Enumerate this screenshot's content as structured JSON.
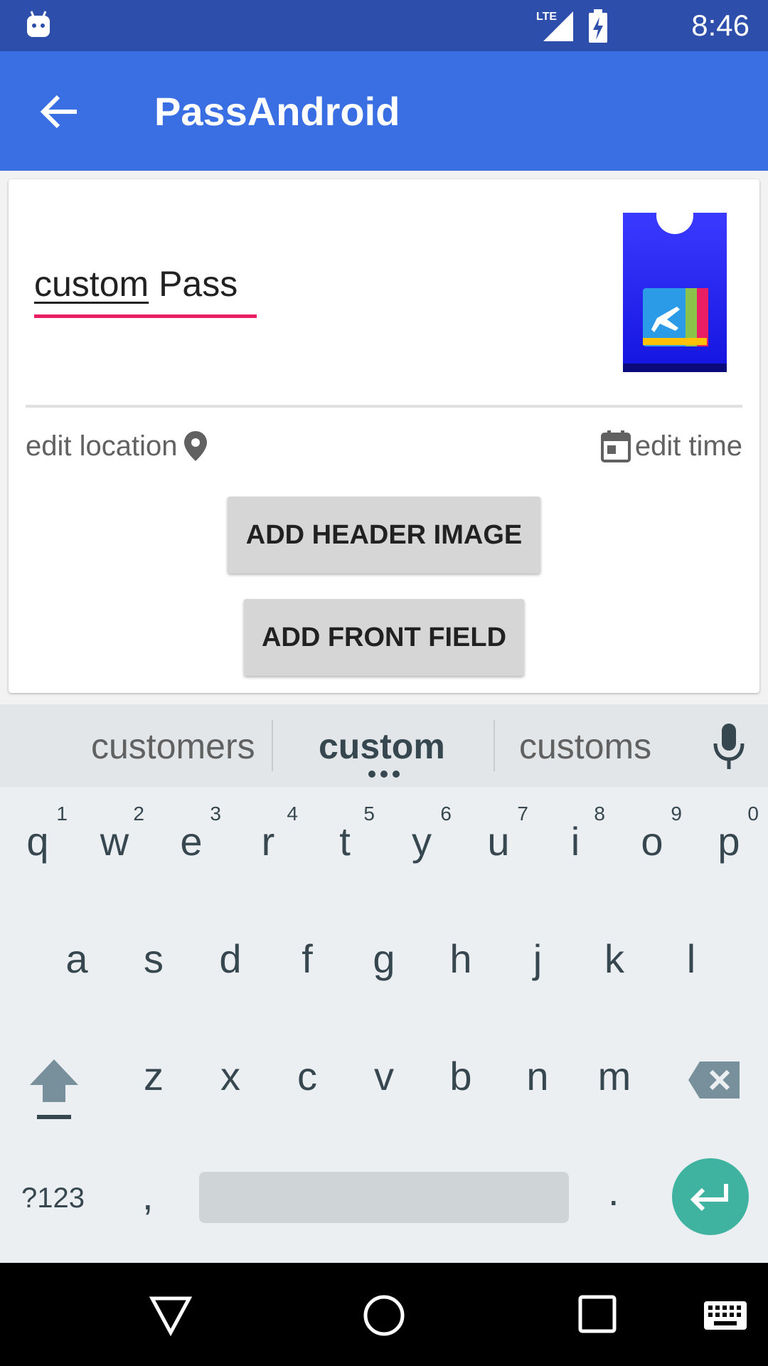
{
  "status_bar": {
    "time": "8:46",
    "network_label": "LTE",
    "icons": [
      "android-notification-icon",
      "lte-signal-icon",
      "battery-charging-icon"
    ]
  },
  "app_bar": {
    "title": "PassAndroid",
    "back_icon": "arrow-back-icon"
  },
  "pass_editor": {
    "description_word_1": "custom",
    "description_word_2": "Pass",
    "thumbnail_icon": "pass-thumbnail-icon",
    "edit_location_label": "edit location",
    "edit_time_label": "edit time",
    "add_header_image_label": "ADD HEADER IMAGE",
    "add_front_field_label": "ADD FRONT FIELD"
  },
  "keyboard": {
    "suggestions": [
      "customers",
      "custom",
      "customs"
    ],
    "row1": [
      {
        "key": "q",
        "hint": "1"
      },
      {
        "key": "w",
        "hint": "2"
      },
      {
        "key": "e",
        "hint": "3"
      },
      {
        "key": "r",
        "hint": "4"
      },
      {
        "key": "t",
        "hint": "5"
      },
      {
        "key": "y",
        "hint": "6"
      },
      {
        "key": "u",
        "hint": "7"
      },
      {
        "key": "i",
        "hint": "8"
      },
      {
        "key": "o",
        "hint": "9"
      },
      {
        "key": "p",
        "hint": "0"
      }
    ],
    "row2": [
      "a",
      "s",
      "d",
      "f",
      "g",
      "h",
      "j",
      "k",
      "l"
    ],
    "row3": [
      "z",
      "x",
      "c",
      "v",
      "b",
      "n",
      "m"
    ],
    "symbols_label": "?123",
    "comma_label": ",",
    "period_label": "."
  },
  "colors": {
    "status_bar": "#2d4fab",
    "app_bar": "#3a6fe4",
    "accent": "#e91e63",
    "enter_key": "#3fb3a0"
  }
}
